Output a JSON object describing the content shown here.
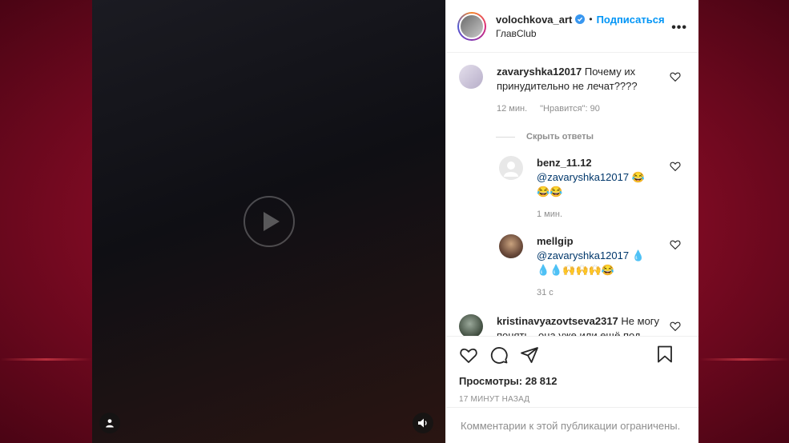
{
  "post": {
    "username": "volochkova_art",
    "verified": true,
    "separator": "•",
    "follow_label": "Подписаться",
    "location": "ГлавClub",
    "more_label": "•••"
  },
  "comments": [
    {
      "username": "zavaryshka12017",
      "text": "Почему их принудительно не лечат????",
      "time": "12 мин.",
      "likes": "\"Нравится\": 90",
      "avatar_color": "#c9c3d6",
      "hide_replies_label": "Скрыть ответы",
      "replies": [
        {
          "username": "benz_11.12",
          "mention": "@zavaryshka12017",
          "text": "😂😂😂",
          "time": "1 мин.",
          "avatar_color": "#e7e7e7"
        },
        {
          "username": "mellgip",
          "mention": "@zavaryshka12017",
          "text": "💧💧💧🙌🙌🙌😂",
          "time": "31 с",
          "avatar_color": "#6a4a3a"
        }
      ]
    },
    {
      "username": "kristinavyazovtseva2317",
      "text": "Не могу понять . она уже или ещё под",
      "avatar_color": "#3d4a3c"
    }
  ],
  "views": {
    "label": "Просмотры:",
    "count": "28 812"
  },
  "timestamp": "17 МИНУТ НАЗАД",
  "comments_restricted": "Комментарии к этой публикации ограничены.",
  "media": {
    "caption": ""
  },
  "colors": {
    "accent": "#0095f6",
    "mention": "#00376b",
    "muted": "#8e8e8e",
    "text": "#262626"
  },
  "icons": [
    "like-icon",
    "comment-icon",
    "share-icon",
    "bookmark-icon",
    "heart-icon",
    "user-tag-icon",
    "sound-icon",
    "more-icon",
    "verified-icon"
  ]
}
